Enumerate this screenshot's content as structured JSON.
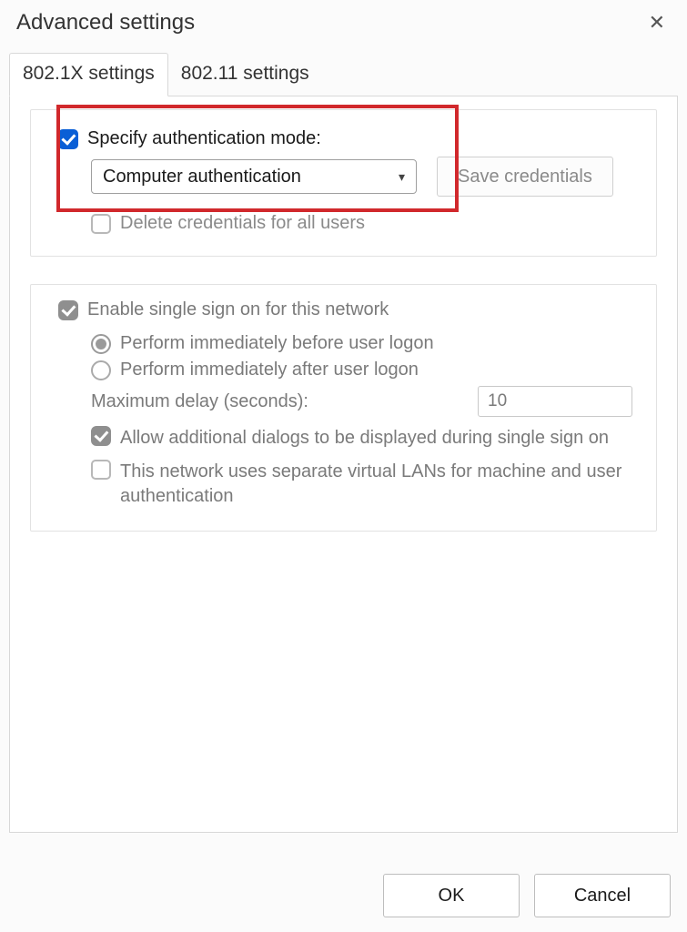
{
  "window": {
    "title": "Advanced settings"
  },
  "tabs": {
    "t0": "802.1X settings",
    "t1": "802.11 settings"
  },
  "auth_group": {
    "specify_checked": true,
    "specify_label": "Specify authentication mode:",
    "mode_selected": "Computer authentication",
    "save_credentials_label": "Save credentials",
    "delete_credentials_label": "Delete credentials for all users"
  },
  "sso_group": {
    "enable_label": "Enable single sign on for this network",
    "radio_before": "Perform immediately before user logon",
    "radio_after": "Perform immediately after user logon",
    "max_delay_label": "Maximum delay (seconds):",
    "max_delay_value": "10",
    "allow_dialogs": "Allow additional dialogs to be displayed during single sign on",
    "sep_vlan": "This network uses separate virtual LANs for machine and user authentication"
  },
  "footer": {
    "ok": "OK",
    "cancel": "Cancel"
  }
}
